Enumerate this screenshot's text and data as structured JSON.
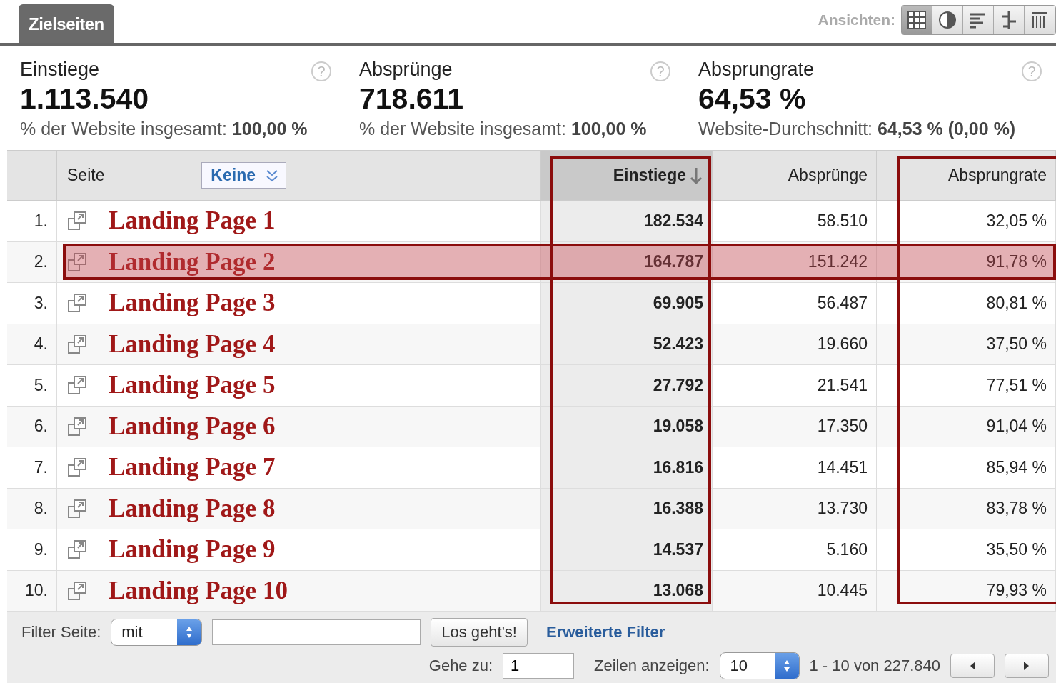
{
  "tab": {
    "label": "Zielseiten",
    "selected": true
  },
  "views": {
    "label": "Ansichten:",
    "items": [
      {
        "kind": "table",
        "selected": true
      },
      {
        "kind": "pie",
        "selected": false
      },
      {
        "kind": "bars",
        "selected": false
      },
      {
        "kind": "compare",
        "selected": false
      },
      {
        "kind": "pivot",
        "selected": false
      }
    ]
  },
  "summary": [
    {
      "title": "Einstiege",
      "value": "1.113.540",
      "note": "% der Website insgesamt: **100,00 %**",
      "help": "?"
    },
    {
      "title": "Absprünge",
      "value": "718.611",
      "note": "% der Website insgesamt: **100,00 %**",
      "help": "?"
    },
    {
      "title": "Absprungrate",
      "value": "64,53 %",
      "note": "Website-Durchschnitt: **64,53 % (0,00 %)**",
      "help": "?"
    }
  ],
  "table": {
    "page_column": {
      "label": "Seite"
    },
    "columns": [
      {
        "label": "Einstiege",
        "sorted": true,
        "highlighted": true
      },
      {
        "label": "Absprünge",
        "sorted": false,
        "highlighted": false
      },
      {
        "label": "Absprungrate",
        "sorted": false,
        "highlighted": true
      }
    ],
    "segment": {
      "value": "Keine"
    },
    "rows": [
      {
        "number": "1.",
        "page": "Landing Page 1",
        "cells": [
          "182.534",
          "58.510",
          "32,05 %"
        ],
        "highlighted": false
      },
      {
        "number": "2.",
        "page": "Landing Page 2",
        "cells": [
          "164.787",
          "151.242",
          "91,78 %"
        ],
        "highlighted": true
      },
      {
        "number": "3.",
        "page": "Landing Page 3",
        "cells": [
          "69.905",
          "56.487",
          "80,81 %"
        ],
        "highlighted": false
      },
      {
        "number": "4.",
        "page": "Landing Page 4",
        "cells": [
          "52.423",
          "19.660",
          "37,50 %"
        ],
        "highlighted": false
      },
      {
        "number": "5.",
        "page": "Landing Page 5",
        "cells": [
          "27.792",
          "21.541",
          "77,51 %"
        ],
        "highlighted": false
      },
      {
        "number": "6.",
        "page": "Landing Page 6",
        "cells": [
          "19.058",
          "17.350",
          "91,04 %"
        ],
        "highlighted": false
      },
      {
        "number": "7.",
        "page": "Landing Page 7",
        "cells": [
          "16.816",
          "14.451",
          "85,94 %"
        ],
        "highlighted": false
      },
      {
        "number": "8.",
        "page": "Landing Page 8",
        "cells": [
          "16.388",
          "13.730",
          "83,78 %"
        ],
        "highlighted": false
      },
      {
        "number": "9.",
        "page": "Landing Page 9",
        "cells": [
          "14.537",
          "5.160",
          "35,50 %"
        ],
        "highlighted": false
      },
      {
        "number": "10.",
        "page": "Landing Page 10",
        "cells": [
          "13.068",
          "10.445",
          "79,93 %"
        ],
        "highlighted": false
      }
    ]
  },
  "filter": {
    "label": "Filter Seite:",
    "mode": "mit",
    "button": "Los geht's!",
    "advanced": "Erweiterte Filter"
  },
  "pager": {
    "goto_label": "Gehe zu:",
    "goto_value": "1",
    "rows_label": "Zeilen anzeigen:",
    "rows_value": "10",
    "range": "1 - 10 von 227.840"
  }
}
